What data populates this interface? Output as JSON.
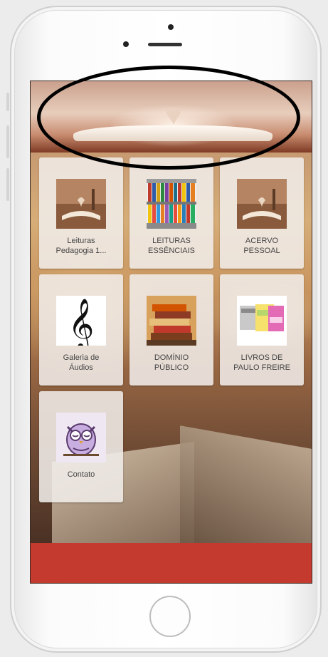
{
  "device": {
    "frame_color": "#ffffff",
    "screen_border_color": "#3a2a22"
  },
  "header": {
    "banner_image": "open-book-heart-image",
    "highlight_color": "#000000"
  },
  "tiles": [
    {
      "label_line1": "Leituras",
      "label_line2": "Pedagogia 1...",
      "icon": "open-book-heart-image"
    },
    {
      "label_line1": "LEITURAS",
      "label_line2": "ESSÊNCIAIS",
      "icon": "bookshelf-image"
    },
    {
      "label_line1": "ACERVO",
      "label_line2": "PESSOAL",
      "icon": "open-book-heart-image"
    },
    {
      "label_line1": "Galeria de",
      "label_line2": "Áudios",
      "icon": "treble-clef-icon"
    },
    {
      "label_line1": "DOMÍNIO",
      "label_line2": "PÚBLICO",
      "icon": "book-stack-image"
    },
    {
      "label_line1": "LIVROS DE",
      "label_line2": "PAULO FREIRE",
      "icon": "book-covers-image"
    },
    {
      "label_line1": "Contato",
      "label_line2": "",
      "icon": "owl-icon"
    }
  ],
  "footer": {
    "color": "#c43a2f"
  }
}
